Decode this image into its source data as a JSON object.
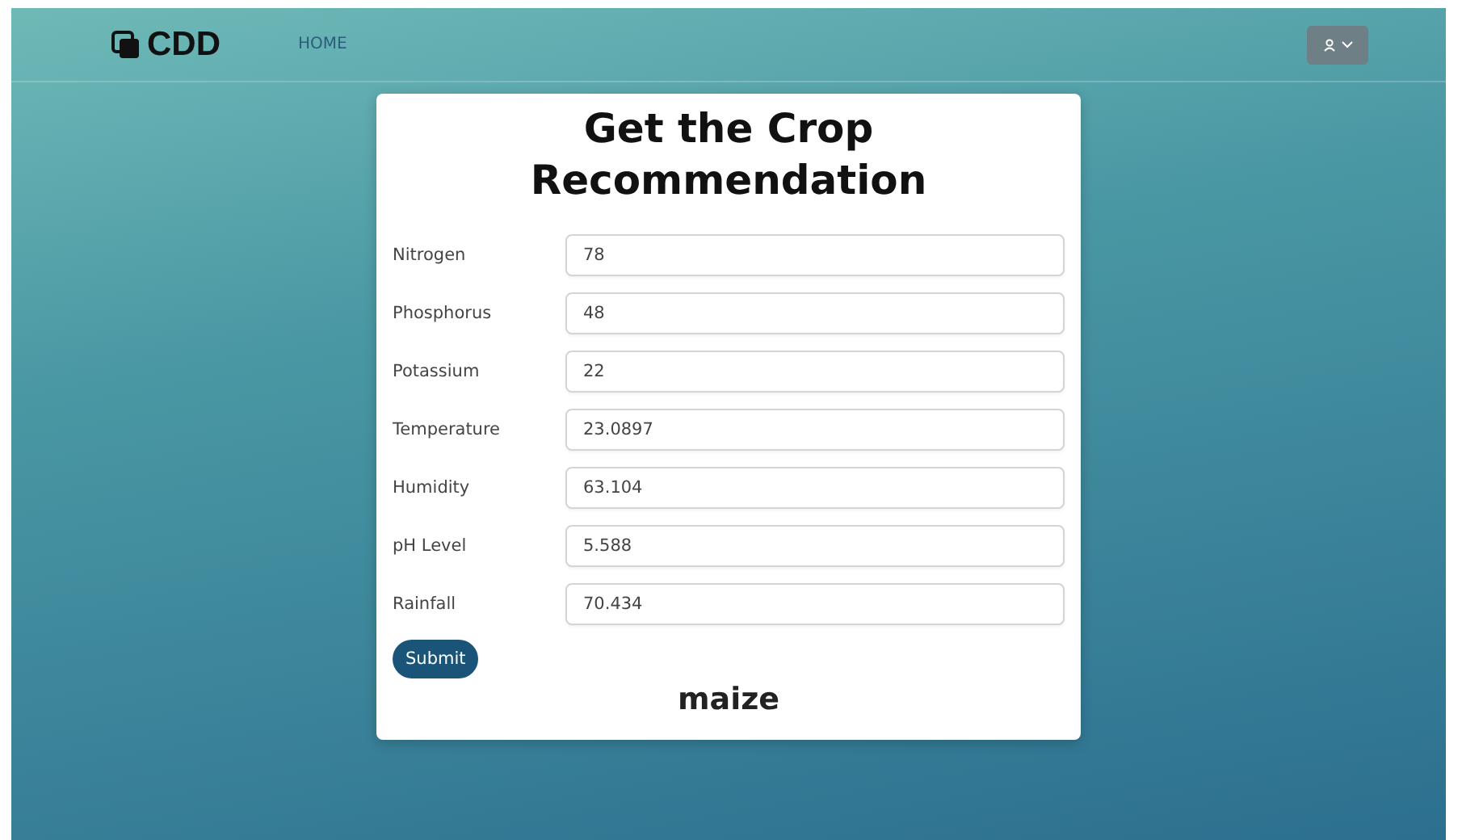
{
  "navbar": {
    "logo": "CDD",
    "links": [
      {
        "label": "HOME"
      }
    ]
  },
  "form": {
    "title": "Get the Crop Recommendation",
    "fields": [
      {
        "label": "Nitrogen",
        "value": "78"
      },
      {
        "label": "Phosphorus",
        "value": "48"
      },
      {
        "label": "Potassium",
        "value": "22"
      },
      {
        "label": "Temperature",
        "value": "23.0897"
      },
      {
        "label": "Humidity",
        "value": "63.104"
      },
      {
        "label": "pH Level",
        "value": "5.588"
      },
      {
        "label": "Rainfall",
        "value": "70.434"
      }
    ],
    "submit": "Submit",
    "result": "maize"
  }
}
